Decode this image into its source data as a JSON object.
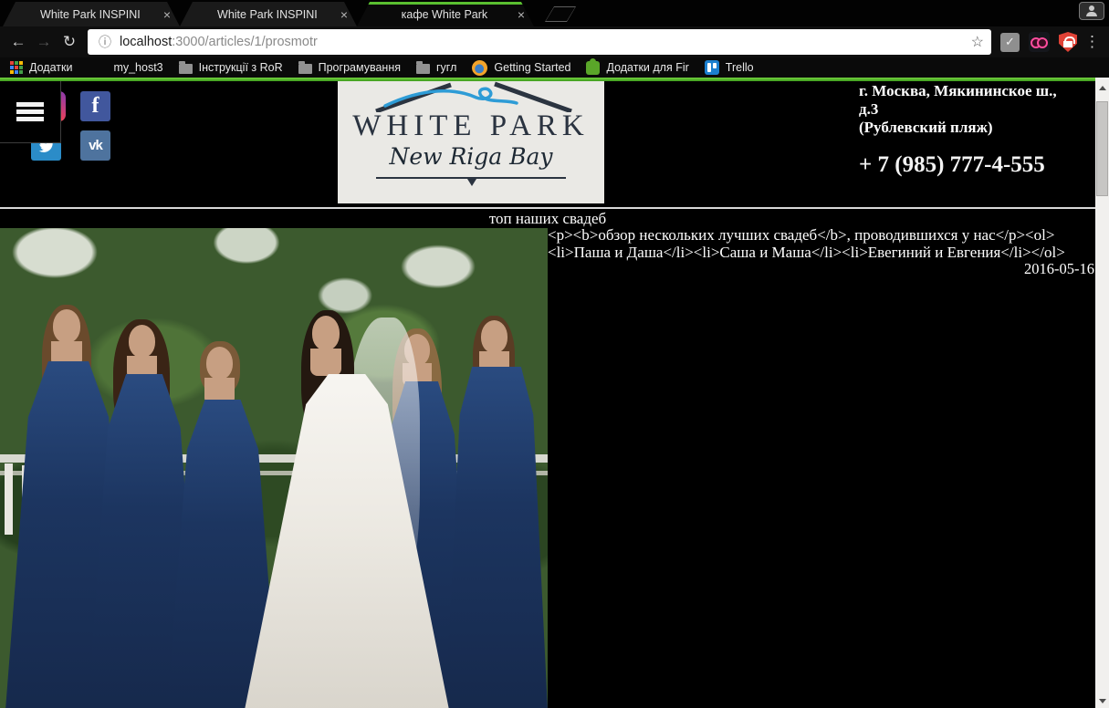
{
  "browser": {
    "tabs": [
      {
        "title": "White Park INSPINI"
      },
      {
        "title": "White Park INSPINI"
      },
      {
        "title": "кафе White Park"
      }
    ],
    "tab_close_glyph": "×",
    "nav": {
      "back_glyph": "←",
      "forward_glyph": "→",
      "reload_glyph": "↻"
    },
    "omnibox": {
      "info_glyph": "ⓘ",
      "host": "localhost",
      "path": ":3000/articles/1/prosmotr",
      "star_glyph": "☆"
    },
    "extensions": {
      "check_glyph": "✓"
    },
    "menu_glyph": "⋮",
    "bookmarks": [
      {
        "label": "Додатки",
        "icon": "apps-grid-icon"
      },
      {
        "label": "my_host3",
        "icon": "none"
      },
      {
        "label": "Інструкції з RoR",
        "icon": "folder-icon"
      },
      {
        "label": "Програмування",
        "icon": "folder-icon"
      },
      {
        "label": "гугл",
        "icon": "folder-icon"
      },
      {
        "label": "Getting Started",
        "icon": "firefox-icon"
      },
      {
        "label": "Додатки для Fir",
        "icon": "puzzle-icon"
      },
      {
        "label": "Trello",
        "icon": "trello-icon"
      }
    ],
    "theme": {
      "accent_green": "#5abf30"
    }
  },
  "page": {
    "social": {
      "facebook_label": "f",
      "vk_label": "vk"
    },
    "logo": {
      "title": "WHITE PARK",
      "subtitle": "New Riga Bay"
    },
    "contact": {
      "address_line1": "г. Москва, Мякининское ш.,",
      "address_line2": "д.3",
      "address_line3": "(Рублевский пляж)",
      "phone": "+ 7 (985) 777-4-555"
    },
    "article": {
      "title": "топ наших свадеб",
      "body": "<p><b>обзор нескольких лучших свадеб</b>, проводившихся у нас</p><ol><li>Паша и Даша</li><li>Саша и Маша</li><li>Евегиний и Евгения</li></ol>",
      "date": "2016-05-16"
    }
  }
}
